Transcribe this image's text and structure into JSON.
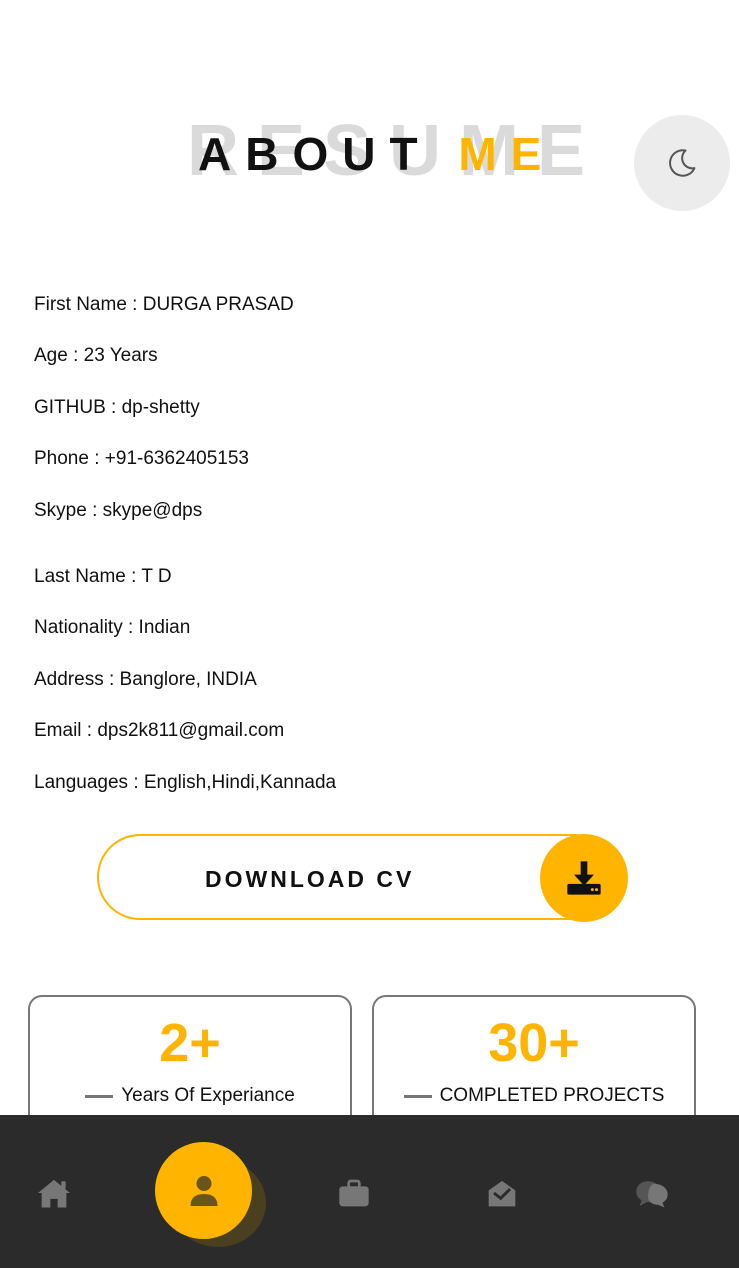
{
  "header": {
    "title_background": "RESUME",
    "title_main": "ABOUT ",
    "title_accent": "ME"
  },
  "personal_info": [
    {
      "label": "First Name",
      "value": "DURGA PRASAD",
      "text": "First Name : DURGA PRASAD"
    },
    {
      "label": "Age",
      "value": "23 Years",
      "text": "Age : 23 Years"
    },
    {
      "label": "GITHUB",
      "value": "dp-shetty",
      "text": "GITHUB : dp-shetty"
    },
    {
      "label": "Phone",
      "value": "+91-6362405153",
      "text": "Phone : +91-6362405153"
    },
    {
      "label": "Skype",
      "value": "skype@dps",
      "text": "Skype : skype@dps"
    },
    {
      "label": "Last Name",
      "value": "T D",
      "text": "Last Name : T D"
    },
    {
      "label": "Nationality",
      "value": "Indian",
      "text": "Nationality : Indian"
    },
    {
      "label": "Address",
      "value": "Banglore, INDIA",
      "text": "Address : Banglore, INDIA"
    },
    {
      "label": "Email",
      "value": "dps2k811@gmail.com",
      "text": "Email : dps2k811@gmail.com"
    },
    {
      "label": "Languages",
      "value": "English,Hindi,Kannada",
      "text": "Languages : English,Hindi,Kannada"
    }
  ],
  "download": {
    "label": "DOWNLOAD CV",
    "icon": "download-icon"
  },
  "stats": [
    {
      "value": "2+",
      "label": "Years Of Experiance"
    },
    {
      "value": "30+",
      "label": "COMPLETED PROJECTS"
    }
  ],
  "nav": {
    "items": [
      "home-icon",
      "user-icon",
      "briefcase-icon",
      "envelope-open-icon",
      "chat-icon"
    ],
    "active": "user-icon"
  },
  "colors": {
    "accent": "#ffb400",
    "nav_bg": "#2b2b2b",
    "text": "#111111"
  },
  "theme_toggle_icon": "moon-icon"
}
